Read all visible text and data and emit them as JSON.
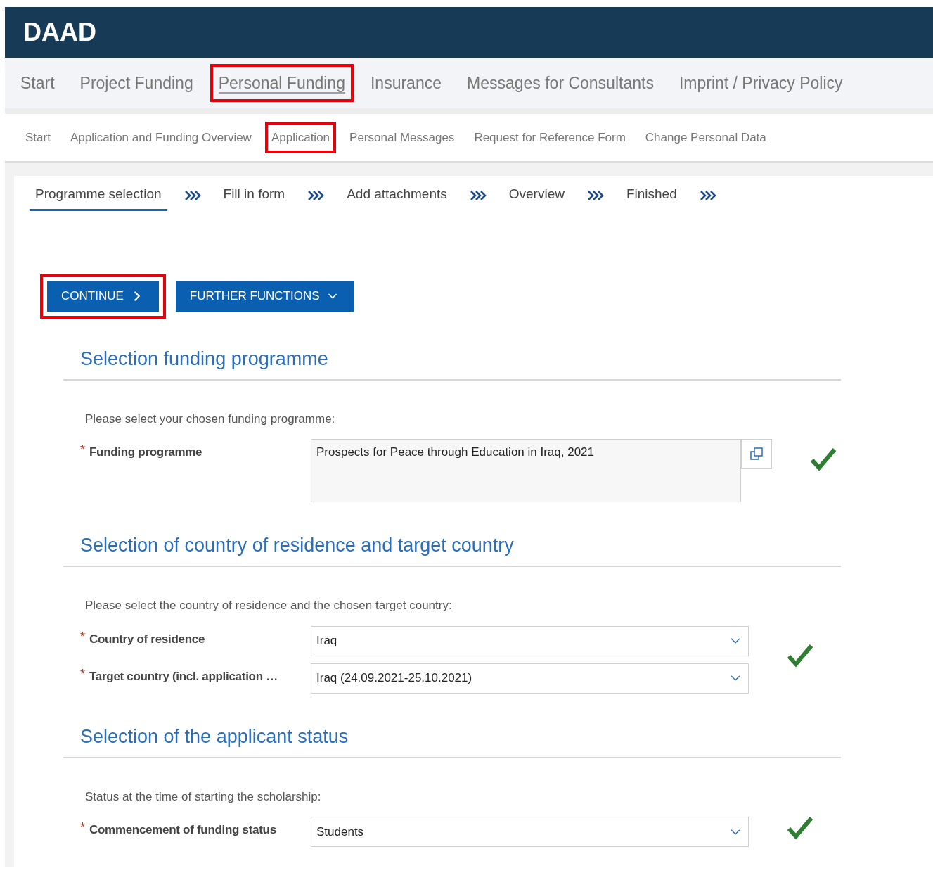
{
  "header": {
    "logo": "DAAD"
  },
  "main_nav": [
    {
      "label": "Start",
      "selected": false,
      "highlighted": false
    },
    {
      "label": "Project Funding",
      "selected": false,
      "highlighted": false
    },
    {
      "label": "Personal Funding",
      "selected": true,
      "highlighted": true
    },
    {
      "label": "Insurance",
      "selected": false,
      "highlighted": false
    },
    {
      "label": "Messages for Consultants",
      "selected": false,
      "highlighted": false
    },
    {
      "label": "Imprint / Privacy Policy",
      "selected": false,
      "highlighted": false
    }
  ],
  "sub_nav": [
    {
      "label": "Start",
      "highlighted": false
    },
    {
      "label": "Application and Funding Overview",
      "highlighted": false
    },
    {
      "label": "Application",
      "highlighted": true
    },
    {
      "label": "Personal Messages",
      "highlighted": false
    },
    {
      "label": "Request for Reference Form",
      "highlighted": false
    },
    {
      "label": "Change Personal Data",
      "highlighted": false
    }
  ],
  "steps": [
    {
      "label": "Programme selection",
      "selected": true
    },
    {
      "label": "Fill in form",
      "selected": false
    },
    {
      "label": "Add attachments",
      "selected": false
    },
    {
      "label": "Overview",
      "selected": false
    },
    {
      "label": "Finished",
      "selected": false
    }
  ],
  "buttons": [
    {
      "label": "CONTINUE",
      "kind": "continue",
      "highlighted": true
    },
    {
      "label": "FURTHER FUNCTIONS",
      "kind": "menu",
      "highlighted": false
    }
  ],
  "sections": [
    {
      "title": "Selection funding programme",
      "instruction": "Please select your chosen funding programme:",
      "valid": true,
      "fields": [
        {
          "label": "Funding programme",
          "required_marker": "*",
          "kind": "lookup",
          "value": "Prospects for Peace through Education in Iraq, 2021"
        }
      ]
    },
    {
      "title": "Selection of country of residence and target country",
      "instruction": "Please select the country of residence and the chosen target country:",
      "valid": true,
      "fields": [
        {
          "label": "Country of residence",
          "required_marker": "*",
          "kind": "select",
          "value": "Iraq"
        },
        {
          "label": "Target country (incl. application …",
          "required_marker": "*",
          "kind": "select",
          "value": "Iraq (24.09.2021-25.10.2021)"
        }
      ]
    },
    {
      "title": "Selection of the applicant status",
      "instruction": "Status at the time of starting the scholarship:",
      "valid": true,
      "fields": [
        {
          "label": "Commencement of funding status",
          "required_marker": "*",
          "kind": "select",
          "value": "Students"
        }
      ]
    }
  ]
}
